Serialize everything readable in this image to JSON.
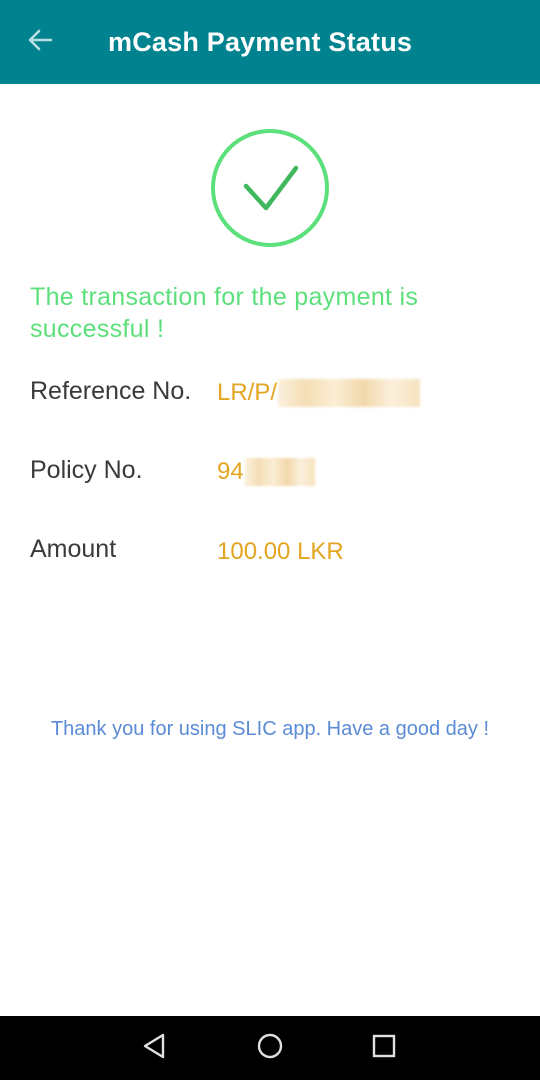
{
  "appbar": {
    "title": "mCash Payment Status",
    "back_icon": "arrow-left-icon",
    "background": "#00838f"
  },
  "status": {
    "icon": "check-circle-icon",
    "icon_color": "#5ce07b",
    "message": "The transaction for the payment is successful !"
  },
  "details": {
    "reference": {
      "label": "Reference No.",
      "value_prefix": "LR/P/"
    },
    "policy": {
      "label": "Policy No.",
      "value_prefix": "94"
    },
    "amount": {
      "label": "Amount",
      "value": "100.00 LKR"
    },
    "value_color": "#e2a421"
  },
  "footer": {
    "thanks": "Thank you for using SLIC app. Have a good day !"
  },
  "system_nav": {
    "back_icon": "triangle-back-icon",
    "home_icon": "circle-home-icon",
    "recents_icon": "square-recents-icon"
  }
}
